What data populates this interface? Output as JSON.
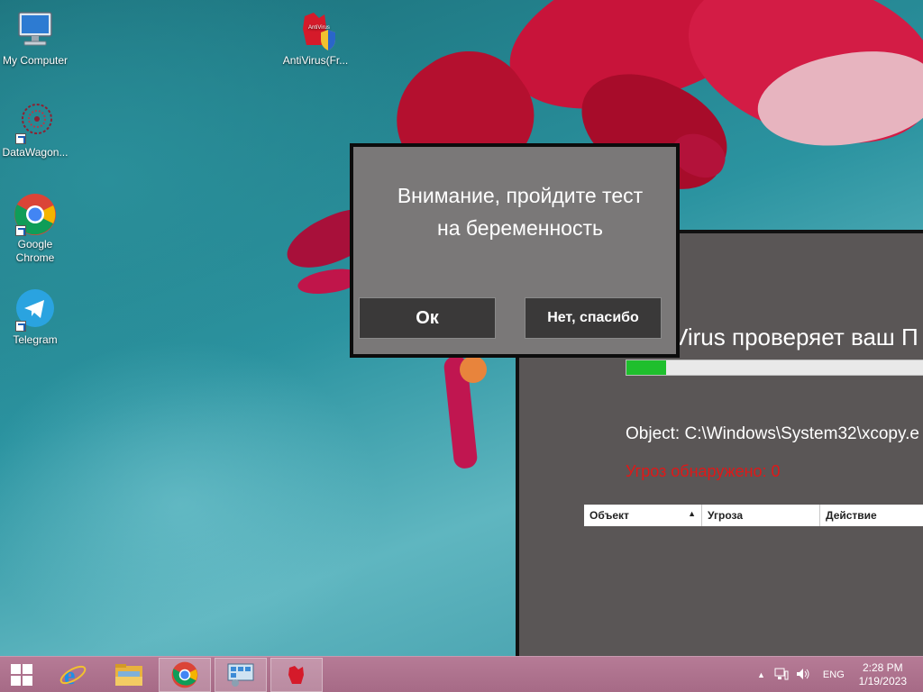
{
  "desktop": {
    "icons": [
      {
        "label": "My Computer"
      },
      {
        "label": "AntiVirus(Fr..."
      },
      {
        "label": "DataWagon..."
      },
      {
        "label": "Google Chrome"
      },
      {
        "label": "Telegram"
      }
    ],
    "antivirus_badge_text": "AntiVirus"
  },
  "antivirus_window": {
    "heading": "Virus проверяет ваш П",
    "progress_fraction": 0.13,
    "object_line": "Object: C:\\Windows\\System32\\xcopy.e",
    "threats_line": "Угроз обнаружено: 0",
    "table_columns": [
      "Объект",
      "Угроза",
      "Действие"
    ]
  },
  "dialog": {
    "message_line1": "Внимание, пройдите тест",
    "message_line2": "на беременность",
    "ok_label": "Ок",
    "no_label": "Нет, спасибо"
  },
  "taskbar": {
    "items": [
      "start-icon",
      "internet-explorer-icon",
      "file-explorer-icon",
      "chrome-icon",
      "control-panel-icon",
      "antivirus-icon"
    ],
    "language": "ENG",
    "time": "2:28 PM",
    "date": "1/19/2023"
  },
  "colors": {
    "dialog_bg": "#7a7878",
    "button_bg": "#3a3939",
    "threat_red": "#e01818",
    "progress_green": "#1fbf2d",
    "taskbar": "#a66a86"
  }
}
